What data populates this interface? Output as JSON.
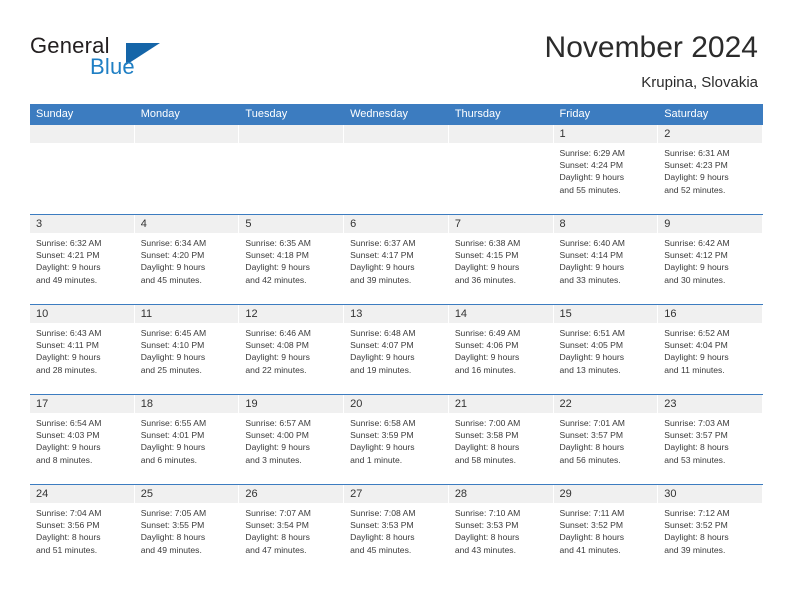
{
  "brand": {
    "word1": "General",
    "word2": "Blue",
    "logo_icon": "blue-triangle-logo"
  },
  "header": {
    "month_title": "November 2024",
    "location": "Krupina, Slovakia"
  },
  "colors": {
    "header_blue": "#3c7cc0",
    "brand_blue": "#1f7fc4",
    "daynum_band": "#f0f0f0",
    "text": "#3a3a3a"
  },
  "calendar": {
    "weekday_headers": [
      "Sunday",
      "Monday",
      "Tuesday",
      "Wednesday",
      "Thursday",
      "Friday",
      "Saturday"
    ],
    "labels": {
      "sunrise": "Sunrise:",
      "sunset": "Sunset:",
      "daylight": "Daylight:"
    },
    "weeks": [
      [
        {
          "day": "",
          "empty": true
        },
        {
          "day": "",
          "empty": true
        },
        {
          "day": "",
          "empty": true
        },
        {
          "day": "",
          "empty": true
        },
        {
          "day": "",
          "empty": true
        },
        {
          "day": "1",
          "sunrise": "Sunrise: 6:29 AM",
          "sunset": "Sunset: 4:24 PM",
          "daylight1": "Daylight: 9 hours",
          "daylight2": "and 55 minutes."
        },
        {
          "day": "2",
          "sunrise": "Sunrise: 6:31 AM",
          "sunset": "Sunset: 4:23 PM",
          "daylight1": "Daylight: 9 hours",
          "daylight2": "and 52 minutes."
        }
      ],
      [
        {
          "day": "3",
          "sunrise": "Sunrise: 6:32 AM",
          "sunset": "Sunset: 4:21 PM",
          "daylight1": "Daylight: 9 hours",
          "daylight2": "and 49 minutes."
        },
        {
          "day": "4",
          "sunrise": "Sunrise: 6:34 AM",
          "sunset": "Sunset: 4:20 PM",
          "daylight1": "Daylight: 9 hours",
          "daylight2": "and 45 minutes."
        },
        {
          "day": "5",
          "sunrise": "Sunrise: 6:35 AM",
          "sunset": "Sunset: 4:18 PM",
          "daylight1": "Daylight: 9 hours",
          "daylight2": "and 42 minutes."
        },
        {
          "day": "6",
          "sunrise": "Sunrise: 6:37 AM",
          "sunset": "Sunset: 4:17 PM",
          "daylight1": "Daylight: 9 hours",
          "daylight2": "and 39 minutes."
        },
        {
          "day": "7",
          "sunrise": "Sunrise: 6:38 AM",
          "sunset": "Sunset: 4:15 PM",
          "daylight1": "Daylight: 9 hours",
          "daylight2": "and 36 minutes."
        },
        {
          "day": "8",
          "sunrise": "Sunrise: 6:40 AM",
          "sunset": "Sunset: 4:14 PM",
          "daylight1": "Daylight: 9 hours",
          "daylight2": "and 33 minutes."
        },
        {
          "day": "9",
          "sunrise": "Sunrise: 6:42 AM",
          "sunset": "Sunset: 4:12 PM",
          "daylight1": "Daylight: 9 hours",
          "daylight2": "and 30 minutes."
        }
      ],
      [
        {
          "day": "10",
          "sunrise": "Sunrise: 6:43 AM",
          "sunset": "Sunset: 4:11 PM",
          "daylight1": "Daylight: 9 hours",
          "daylight2": "and 28 minutes."
        },
        {
          "day": "11",
          "sunrise": "Sunrise: 6:45 AM",
          "sunset": "Sunset: 4:10 PM",
          "daylight1": "Daylight: 9 hours",
          "daylight2": "and 25 minutes."
        },
        {
          "day": "12",
          "sunrise": "Sunrise: 6:46 AM",
          "sunset": "Sunset: 4:08 PM",
          "daylight1": "Daylight: 9 hours",
          "daylight2": "and 22 minutes."
        },
        {
          "day": "13",
          "sunrise": "Sunrise: 6:48 AM",
          "sunset": "Sunset: 4:07 PM",
          "daylight1": "Daylight: 9 hours",
          "daylight2": "and 19 minutes."
        },
        {
          "day": "14",
          "sunrise": "Sunrise: 6:49 AM",
          "sunset": "Sunset: 4:06 PM",
          "daylight1": "Daylight: 9 hours",
          "daylight2": "and 16 minutes."
        },
        {
          "day": "15",
          "sunrise": "Sunrise: 6:51 AM",
          "sunset": "Sunset: 4:05 PM",
          "daylight1": "Daylight: 9 hours",
          "daylight2": "and 13 minutes."
        },
        {
          "day": "16",
          "sunrise": "Sunrise: 6:52 AM",
          "sunset": "Sunset: 4:04 PM",
          "daylight1": "Daylight: 9 hours",
          "daylight2": "and 11 minutes."
        }
      ],
      [
        {
          "day": "17",
          "sunrise": "Sunrise: 6:54 AM",
          "sunset": "Sunset: 4:03 PM",
          "daylight1": "Daylight: 9 hours",
          "daylight2": "and 8 minutes."
        },
        {
          "day": "18",
          "sunrise": "Sunrise: 6:55 AM",
          "sunset": "Sunset: 4:01 PM",
          "daylight1": "Daylight: 9 hours",
          "daylight2": "and 6 minutes."
        },
        {
          "day": "19",
          "sunrise": "Sunrise: 6:57 AM",
          "sunset": "Sunset: 4:00 PM",
          "daylight1": "Daylight: 9 hours",
          "daylight2": "and 3 minutes."
        },
        {
          "day": "20",
          "sunrise": "Sunrise: 6:58 AM",
          "sunset": "Sunset: 3:59 PM",
          "daylight1": "Daylight: 9 hours",
          "daylight2": "and 1 minute."
        },
        {
          "day": "21",
          "sunrise": "Sunrise: 7:00 AM",
          "sunset": "Sunset: 3:58 PM",
          "daylight1": "Daylight: 8 hours",
          "daylight2": "and 58 minutes."
        },
        {
          "day": "22",
          "sunrise": "Sunrise: 7:01 AM",
          "sunset": "Sunset: 3:57 PM",
          "daylight1": "Daylight: 8 hours",
          "daylight2": "and 56 minutes."
        },
        {
          "day": "23",
          "sunrise": "Sunrise: 7:03 AM",
          "sunset": "Sunset: 3:57 PM",
          "daylight1": "Daylight: 8 hours",
          "daylight2": "and 53 minutes."
        }
      ],
      [
        {
          "day": "24",
          "sunrise": "Sunrise: 7:04 AM",
          "sunset": "Sunset: 3:56 PM",
          "daylight1": "Daylight: 8 hours",
          "daylight2": "and 51 minutes."
        },
        {
          "day": "25",
          "sunrise": "Sunrise: 7:05 AM",
          "sunset": "Sunset: 3:55 PM",
          "daylight1": "Daylight: 8 hours",
          "daylight2": "and 49 minutes."
        },
        {
          "day": "26",
          "sunrise": "Sunrise: 7:07 AM",
          "sunset": "Sunset: 3:54 PM",
          "daylight1": "Daylight: 8 hours",
          "daylight2": "and 47 minutes."
        },
        {
          "day": "27",
          "sunrise": "Sunrise: 7:08 AM",
          "sunset": "Sunset: 3:53 PM",
          "daylight1": "Daylight: 8 hours",
          "daylight2": "and 45 minutes."
        },
        {
          "day": "28",
          "sunrise": "Sunrise: 7:10 AM",
          "sunset": "Sunset: 3:53 PM",
          "daylight1": "Daylight: 8 hours",
          "daylight2": "and 43 minutes."
        },
        {
          "day": "29",
          "sunrise": "Sunrise: 7:11 AM",
          "sunset": "Sunset: 3:52 PM",
          "daylight1": "Daylight: 8 hours",
          "daylight2": "and 41 minutes."
        },
        {
          "day": "30",
          "sunrise": "Sunrise: 7:12 AM",
          "sunset": "Sunset: 3:52 PM",
          "daylight1": "Daylight: 8 hours",
          "daylight2": "and 39 minutes."
        }
      ]
    ]
  }
}
